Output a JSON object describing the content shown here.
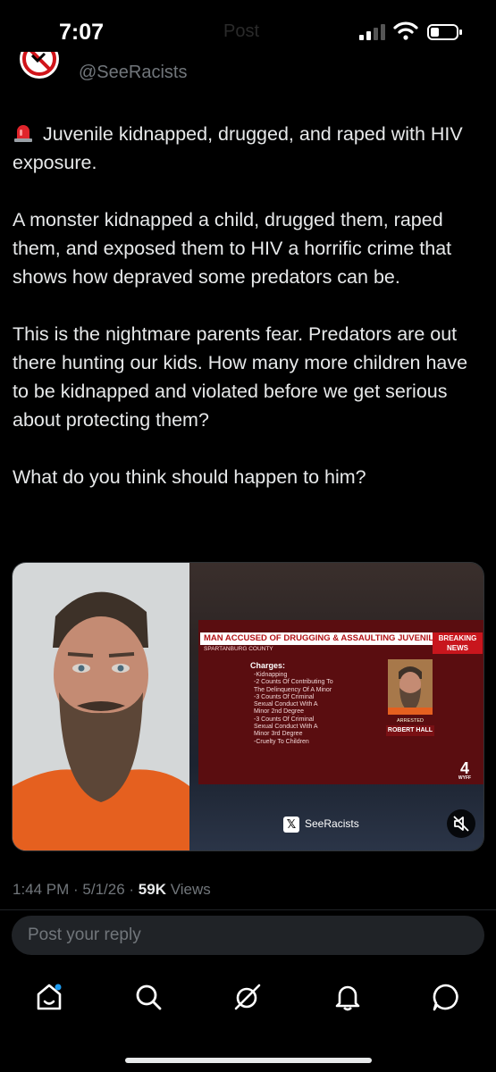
{
  "status_bar": {
    "time": "7:07",
    "ghost_text": "Post",
    "icons": [
      "signal-icon",
      "wifi-icon",
      "battery-icon"
    ]
  },
  "author": {
    "handle": "@SeeRacists",
    "avatar_icon": "no-racism-avatar-icon"
  },
  "tweet": {
    "headline": "Juvenile kidnapped, drugged, and raped with HIV exposure.",
    "paragraphs": [
      "A monster kidnapped a child, drugged them, raped them, and exposed them to HIV a horrific crime that shows how depraved some predators can be.",
      "This is the nightmare parents fear. Predators are out there hunting our kids. How many more children have to be kidnapped and violated before we get serious about protecting them?",
      "What do you think should happen to him?"
    ],
    "emoji_icon": "rotating-light-icon"
  },
  "media": {
    "news_headline": "MAN ACCUSED OF DRUGGING & ASSAULTING JUVENILE",
    "news_sub": "SPARTANBURG COUNTY",
    "breaking": "BREAKING NEWS",
    "charges_title": "Charges:",
    "charges": [
      "-Kidnapping",
      "-2 Counts Of Contributing To",
      "The Delinquency Of A Minor",
      "-3 Counts Of Criminal",
      "Sexual Conduct With A",
      "Minor 2nd Degree",
      "-3 Counts Of Criminal",
      "Sexual Conduct With A",
      "Minor 3rd Degree",
      "-Cruelty To Children"
    ],
    "arrested_label": "ARRESTED",
    "arrested_name": "ROBERT HALL",
    "station": "4",
    "station_sub": "WYFF",
    "watermark": "SeeRacists",
    "mute_icon": "mute-icon"
  },
  "meta": {
    "time": "1:44 PM",
    "date": "5/1/26",
    "views_count": "59K",
    "views_label": "Views"
  },
  "reply": {
    "placeholder": "Post your reply"
  },
  "nav": [
    "home-icon",
    "search-icon",
    "grok-icon",
    "notifications-icon",
    "messages-icon"
  ],
  "colors": {
    "background": "#000000",
    "text": "#e7e9ea",
    "muted": "#71767b",
    "accent_red": "#c8161d"
  }
}
